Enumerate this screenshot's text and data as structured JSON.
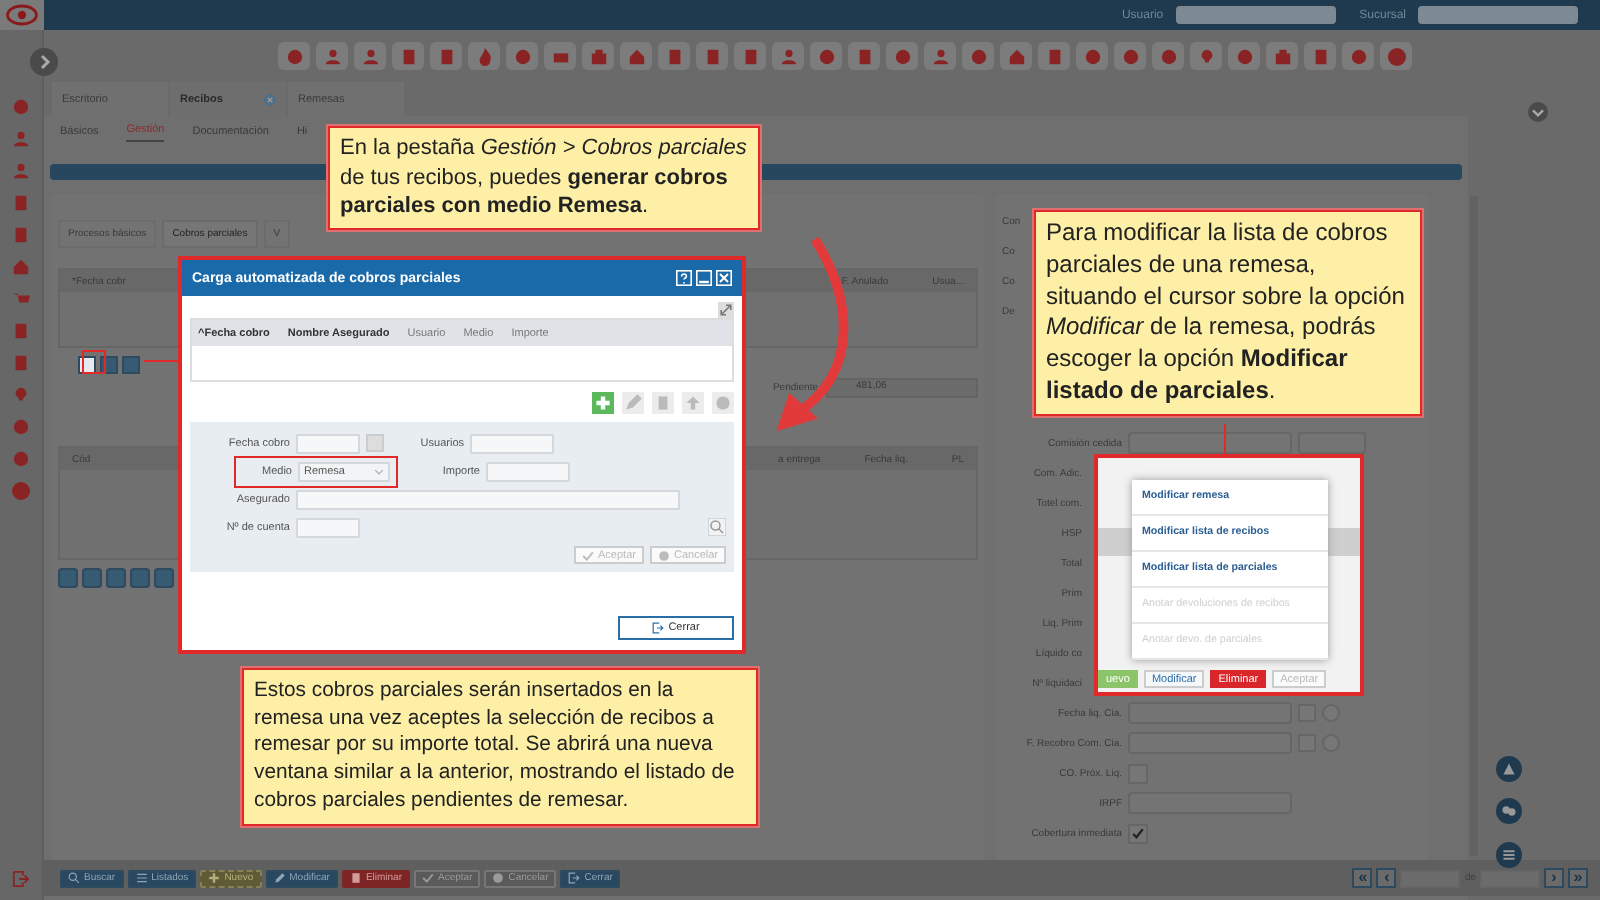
{
  "topbar": {
    "user_label": "Usuario",
    "branch_label": "Sucursal"
  },
  "main_tabs": [
    {
      "label": "Escritorio",
      "selected": false,
      "closable": false
    },
    {
      "label": "Recibos",
      "selected": true,
      "closable": true
    },
    {
      "label": "Remesas",
      "selected": false,
      "closable": false
    }
  ],
  "sub_tabs": [
    {
      "label": "Básicos",
      "selected": false
    },
    {
      "label": "Gestión",
      "selected": true
    },
    {
      "label": "Documentación",
      "selected": false
    },
    {
      "label": "Hi",
      "selected": false
    }
  ],
  "panel_tabs": [
    {
      "label": "Procesos básicos",
      "selected": false
    },
    {
      "label": "Cobros parciales",
      "selected": true
    },
    {
      "label": "V",
      "selected": false
    }
  ],
  "grid1": {
    "left_column": "*Fecha cobr",
    "right_columns": [
      "F. Anulado",
      "Usua..."
    ],
    "pending_label": "Pendiente",
    "pending_value": "481,06"
  },
  "grid2": {
    "left_column": "Cód",
    "right_columns": [
      "a entrega",
      "Fecha liq.",
      "PL"
    ]
  },
  "form": [
    {
      "label": "Con",
      "kind": "cut"
    },
    {
      "label": "Co",
      "kind": "cut"
    },
    {
      "label": "Co",
      "kind": "cut"
    },
    {
      "label": "De",
      "kind": "cut"
    },
    {
      "label": "Comisión cedida",
      "kind": "double"
    },
    {
      "label": "Com. Adic.",
      "kind": "covered"
    },
    {
      "label": "Totel com.",
      "kind": "covered"
    },
    {
      "label": "HSP",
      "kind": "covered"
    },
    {
      "label": "Total",
      "kind": "covered"
    },
    {
      "label": "Prim",
      "kind": "covered"
    },
    {
      "label": "Liq. Prim",
      "kind": "covered"
    },
    {
      "label": "Líquido co",
      "kind": "covered"
    },
    {
      "label": "Nº liquidaci",
      "kind": "covered"
    },
    {
      "label": "Fecha liq. Cia.",
      "kind": "date"
    },
    {
      "label": "F. Recobro Com. Cia.",
      "kind": "date"
    },
    {
      "label": "CO. Próx. Liq.",
      "kind": "check",
      "checked": false
    },
    {
      "label": "IRPF",
      "kind": "field"
    },
    {
      "label": "Cobertura inmediata",
      "kind": "check",
      "checked": true
    }
  ],
  "bottom_buttons": [
    {
      "label": "Buscar",
      "kind": "primary"
    },
    {
      "label": "Listados",
      "kind": "primary"
    },
    {
      "label": "Nuevo",
      "kind": "new"
    },
    {
      "label": "Modificar",
      "kind": "primary"
    },
    {
      "label": "Eliminar",
      "kind": "danger"
    },
    {
      "label": "Aceptar",
      "kind": "disabled"
    },
    {
      "label": "Cancelar",
      "kind": "disabled"
    },
    {
      "label": "Cerrar",
      "kind": "primary"
    }
  ],
  "pager": {
    "first": "«",
    "prev": "‹",
    "of_label": "de",
    "next": "›",
    "last": "»"
  },
  "dialog": {
    "title": "Carga automatizada de cobros parciales",
    "columns": [
      "^Fecha cobro",
      "Nombre Asegurado",
      "Usuario",
      "Medio",
      "Importe"
    ],
    "fecha_label": "Fecha cobro",
    "usuarios_label": "Usuarios",
    "medio_label": "Medio",
    "medio_value": "Remesa",
    "importe_label": "Importe",
    "asegurado_label": "Asegurado",
    "cuenta_label": "Nº de cuenta",
    "accept": {
      "label": "Aceptar",
      "disabled": true
    },
    "cancel": {
      "label": "Cancelar",
      "disabled": true
    },
    "close": "Cerrar"
  },
  "callouts": [
    {
      "text": "En la pestaña *Gestión > Cobros parciales* de tus recibos, puedes **generar cobros parciales con medio Remesa**."
    },
    {
      "text": "Para modificar la lista de cobros parciales de una remesa, situando el cursor sobre la opción *Modificar* de la remesa, podrás escoger la opción **Modificar listado de parciales**."
    },
    {
      "text": "Estos cobros parciales serán insertados en la remesa una vez aceptes la selección de recibos a remesar por su importe total. Se abrirá una nueva ventana similar a la anterior, mostrando el listado de cobros parciales pendientes de remesar."
    }
  ],
  "popup": {
    "menu": [
      {
        "label": "Modificar remesa",
        "disabled": false
      },
      {
        "label": "Modificar lista de recibos",
        "disabled": false
      },
      {
        "label": "Modificar lista de parciales",
        "disabled": false
      },
      {
        "label": "Anotar devoluciones de recibos",
        "disabled": true
      },
      {
        "label": "Anotar devo. de parciales",
        "disabled": true
      }
    ],
    "buttons": [
      {
        "label": "uevo",
        "kind": "new"
      },
      {
        "label": "Modificar",
        "kind": "outline"
      },
      {
        "label": "Eliminar",
        "kind": "danger"
      },
      {
        "label": "Aceptar",
        "kind": "disabled"
      }
    ]
  }
}
